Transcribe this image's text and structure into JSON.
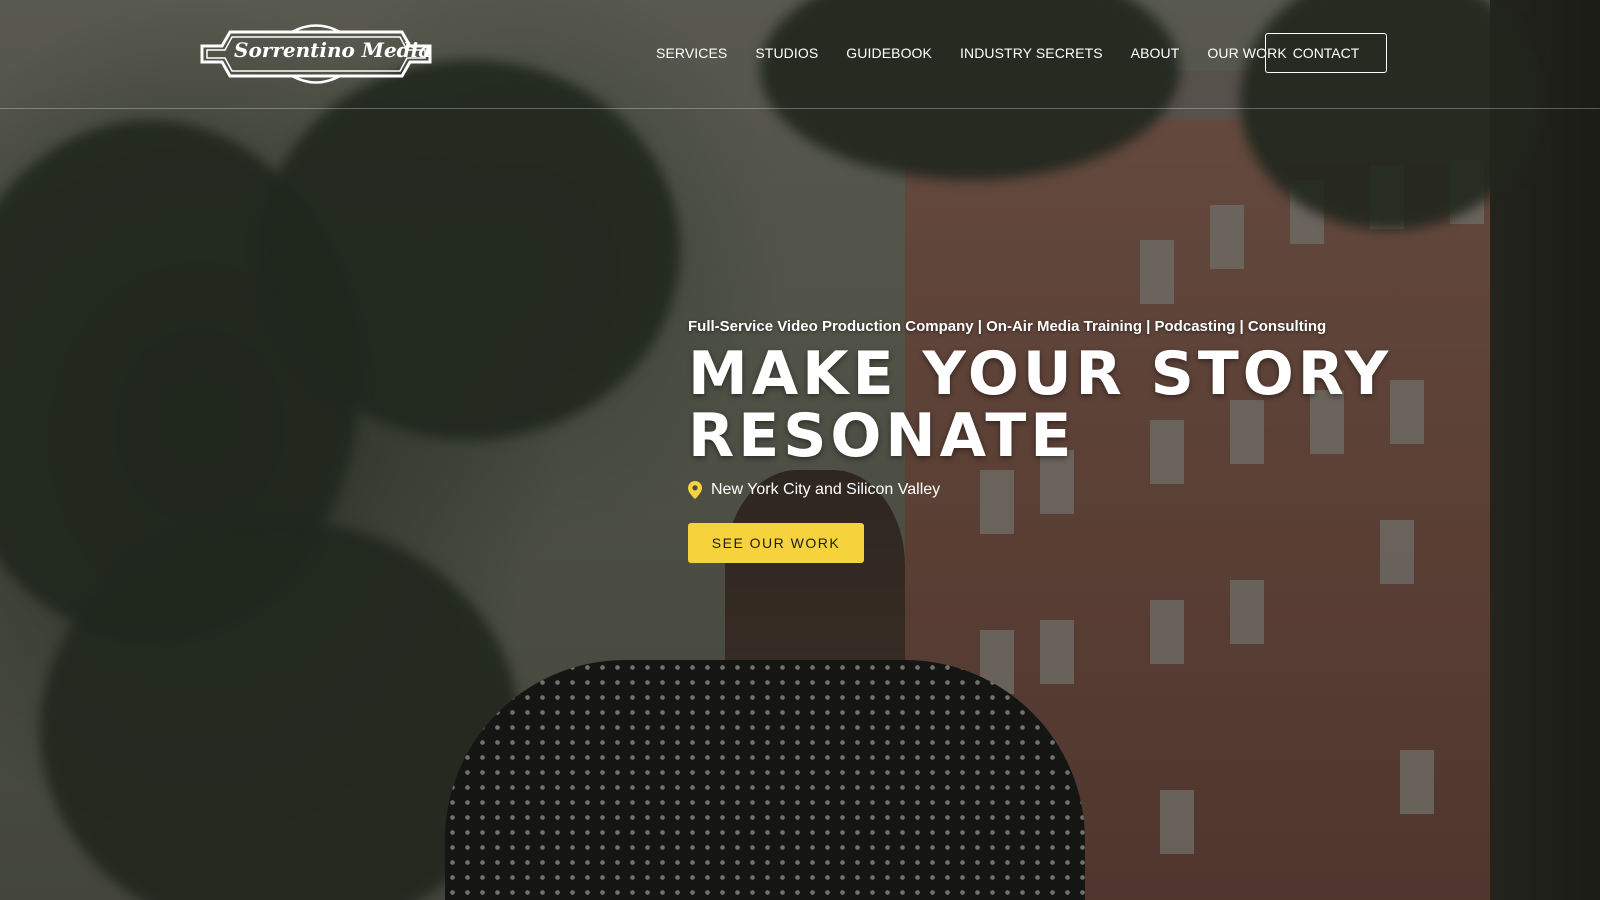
{
  "brand": {
    "logo_text": "Sorrentino Media"
  },
  "nav": {
    "items": [
      {
        "label": "SERVICES"
      },
      {
        "label": "STUDIOS"
      },
      {
        "label": "GUIDEBOOK"
      },
      {
        "label": "INDUSTRY SECRETS"
      },
      {
        "label": "ABOUT"
      },
      {
        "label": "OUR WORK"
      }
    ],
    "contact_label": "CONTACT"
  },
  "hero": {
    "subtitle": "Full-Service Video Production Company | On-Air Media Training | Podcasting | Consulting",
    "title_line1": "MAKE YOUR STORY",
    "title_line2": "RESONATE",
    "location_icon": "map-pin-icon",
    "location": "New York City and Silicon Valley",
    "cta_label": "SEE OUR WORK"
  },
  "colors": {
    "accent": "#f6d33c",
    "text": "#ffffff",
    "cta_text": "#1d1d1d"
  }
}
